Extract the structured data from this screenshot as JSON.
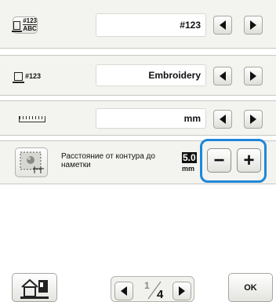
{
  "settings": {
    "row1": {
      "icon": "frame-number-abc-icon",
      "icon_top": "#123",
      "icon_bottom": "ABC",
      "value": "#123"
    },
    "row2": {
      "icon": "frame-number-icon",
      "icon_text": "#123",
      "value": "Embroidery"
    },
    "row3": {
      "icon": "ruler-icon",
      "value": "mm"
    },
    "row4": {
      "icon": "basting-distance-icon",
      "label": "Расстояние от контура до наметки",
      "value": "5.0",
      "unit": "mm",
      "minus": "−",
      "plus": "+"
    }
  },
  "footer": {
    "home_icon": "home-machine-icon",
    "page_current": "1",
    "page_total": "4",
    "ok_label": "OK"
  },
  "colors": {
    "highlight": "#1e87d8",
    "panel": "#f3f3ef"
  }
}
